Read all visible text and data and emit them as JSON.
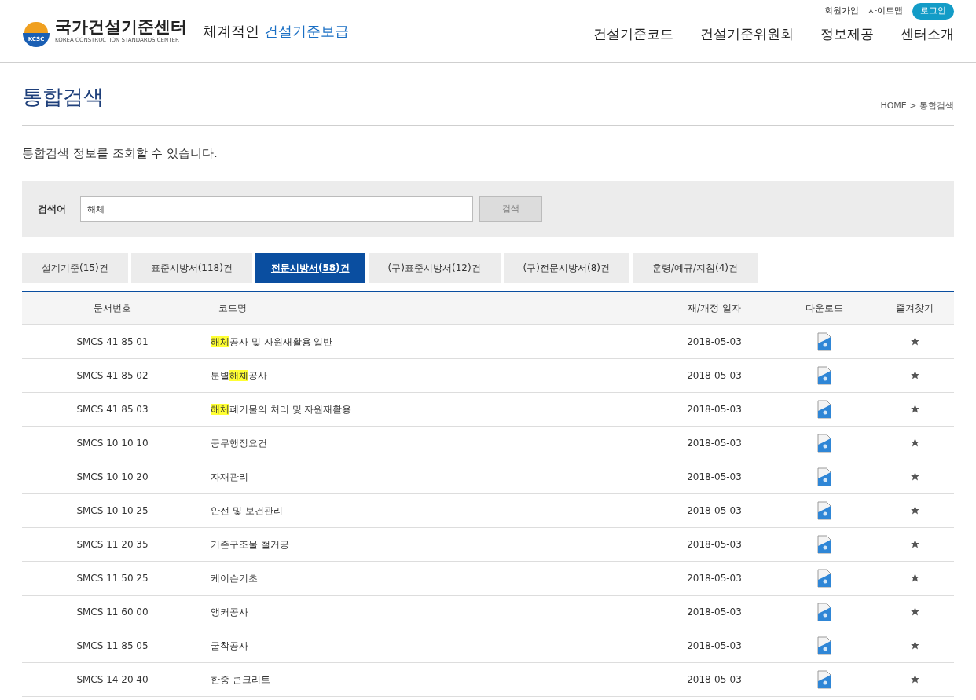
{
  "header": {
    "logo_title": "국가건설기준센터",
    "logo_subtitle": "KOREA CONSTRUCTION STANDARDS CENTER",
    "logo_badge": "KCSC",
    "slogan_plain": "체계적인",
    "slogan_accent": "건설기준보급",
    "util_links": [
      "회원가입",
      "사이트맵"
    ],
    "login": "로그인",
    "nav": [
      "건설기준코드",
      "건설기준위원회",
      "정보제공",
      "센터소개"
    ]
  },
  "page": {
    "title": "통합검색",
    "breadcrumb": "HOME > 통합검색",
    "description": "통합검색 정보를 조회할 수 있습니다."
  },
  "search": {
    "label": "검색어",
    "value": "해체",
    "button": "검색",
    "button_disabled": true
  },
  "tabs": [
    {
      "label": "설계기준(15)건",
      "selected": false
    },
    {
      "label": "표준시방서(118)건",
      "selected": false
    },
    {
      "label": "전문시방서(58)건",
      "selected": true
    },
    {
      "label": "(구)표준시방서(12)건",
      "selected": false
    },
    {
      "label": "(구)전문시방서(8)건",
      "selected": false
    },
    {
      "label": "훈령/예규/지침(4)건",
      "selected": false
    }
  ],
  "table": {
    "columns": [
      "문서번호",
      "코드명",
      "재/개정 일자",
      "다운로드",
      "즐겨찾기"
    ],
    "rows": [
      {
        "number": "SMCS 41 85 01",
        "name": [
          {
            "text": "해체",
            "highlight": true
          },
          {
            "text": "공사 및 자원재활용 일반",
            "highlight": false
          }
        ],
        "date": "2018-05-03"
      },
      {
        "number": "SMCS 41 85 02",
        "name": [
          {
            "text": "분별",
            "highlight": false
          },
          {
            "text": "해체",
            "highlight": true
          },
          {
            "text": "공사",
            "highlight": false
          }
        ],
        "date": "2018-05-03"
      },
      {
        "number": "SMCS 41 85 03",
        "name": [
          {
            "text": "해체",
            "highlight": true
          },
          {
            "text": "폐기물의 처리 및 자원재활용",
            "highlight": false
          }
        ],
        "date": "2018-05-03"
      },
      {
        "number": "SMCS 10 10 10",
        "name": [
          {
            "text": "공무행정요건",
            "highlight": false
          }
        ],
        "date": "2018-05-03"
      },
      {
        "number": "SMCS 10 10 20",
        "name": [
          {
            "text": "자재관리",
            "highlight": false
          }
        ],
        "date": "2018-05-03"
      },
      {
        "number": "SMCS 10 10 25",
        "name": [
          {
            "text": "안전 및 보건관리",
            "highlight": false
          }
        ],
        "date": "2018-05-03"
      },
      {
        "number": "SMCS 11 20 35",
        "name": [
          {
            "text": "기존구조물 철거공",
            "highlight": false
          }
        ],
        "date": "2018-05-03"
      },
      {
        "number": "SMCS 11 50 25",
        "name": [
          {
            "text": "케이슨기초",
            "highlight": false
          }
        ],
        "date": "2018-05-03"
      },
      {
        "number": "SMCS 11 60 00",
        "name": [
          {
            "text": "앵커공사",
            "highlight": false
          }
        ],
        "date": "2018-05-03"
      },
      {
        "number": "SMCS 11 85 05",
        "name": [
          {
            "text": "굴착공사",
            "highlight": false
          }
        ],
        "date": "2018-05-03"
      },
      {
        "number": "SMCS 14 20 40",
        "name": [
          {
            "text": "한중 콘크리트",
            "highlight": false
          }
        ],
        "date": "2018-05-03"
      }
    ]
  }
}
